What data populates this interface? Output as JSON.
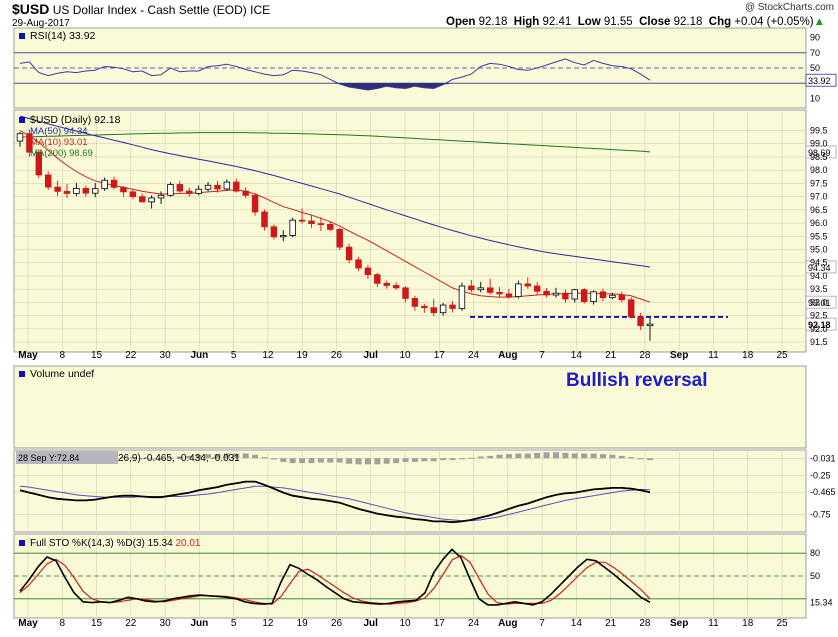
{
  "header": {
    "symbol": "$USD",
    "name": "US Dollar Index - Cash Settle (EOD)",
    "exchange": "ICE",
    "date": "29-Aug-2017",
    "open_label": "Open",
    "open": "92.18",
    "high_label": "High",
    "high": "92.41",
    "low_label": "Low",
    "low": "91.55",
    "close_label": "Close",
    "close": "92.18",
    "chg_label": "Chg",
    "chg": "+0.04 (+0.05%)",
    "brand": "@ StockCharts.com",
    "up_arrow_color": "#1a9a1a"
  },
  "annotation": "Bullish reversal",
  "colors": {
    "panel_bg": "#fafad6",
    "grid": "#c8c8b4",
    "candle_up": "#ffffff",
    "candle_down": "#d01818",
    "ma50": "#2828a0",
    "ma10": "#d02020",
    "ma200": "#1a7a1a",
    "rsi": "#3a3aa0",
    "macd": "#000000",
    "macd_signal": "#5050c0",
    "macd_hist": "#a0a0a0",
    "stoch_k": "#000000",
    "stoch_d": "#d02020",
    "support_line": "#1010b0"
  },
  "chart_data": [
    {
      "type": "line",
      "name": "rsi-panel",
      "legend": "RSI(14) 33.92",
      "last_label": "33.92",
      "ylim": [
        0,
        100
      ],
      "y_ticks": [
        "90",
        "70",
        "50",
        "30",
        "10"
      ],
      "y_tick_values": [
        90,
        70,
        50,
        30,
        10
      ],
      "reference_lines": [
        70,
        50,
        30
      ],
      "values": [
        56,
        58,
        44,
        40,
        43,
        45,
        44,
        46,
        47,
        52,
        51,
        49,
        45,
        46,
        40,
        41,
        50,
        45,
        46,
        46,
        52,
        53,
        55,
        52,
        48,
        45,
        42,
        40,
        41,
        47,
        46,
        44,
        41,
        35,
        29,
        25,
        23,
        21,
        23,
        26,
        24,
        23,
        26,
        24,
        23,
        28,
        35,
        38,
        42,
        52,
        56,
        55,
        52,
        48,
        47,
        50,
        54,
        58,
        62,
        57,
        54,
        60,
        56,
        53,
        52,
        49,
        42,
        33.92
      ]
    },
    {
      "type": "candlestick",
      "name": "price-panel",
      "title": "$USD (Daily) 92.18",
      "legend": [
        {
          "name": "MA(50) 94.34",
          "color": "#2828a0"
        },
        {
          "name": "MA(10) 93.01",
          "color": "#d02020"
        },
        {
          "name": "MA(200) 98.69",
          "color": "#1a7a1a"
        }
      ],
      "ylim": [
        91.2,
        100.2
      ],
      "y_ticks": [
        "99.5",
        "99.0",
        "98.5",
        "98.0",
        "97.5",
        "97.0",
        "96.5",
        "96.0",
        "95.5",
        "95.0",
        "94.5",
        "94.0",
        "93.5",
        "93.0",
        "92.5",
        "92.0",
        "91.5"
      ],
      "y_tick_values": [
        99.5,
        99.0,
        98.5,
        98.0,
        97.5,
        97.0,
        96.5,
        96.0,
        95.5,
        95.0,
        94.5,
        94.0,
        93.5,
        93.0,
        92.5,
        92.0,
        91.5
      ],
      "last_labels": [
        {
          "text": "98.69",
          "value": 98.69
        },
        {
          "text": "94.34",
          "value": 94.34
        },
        {
          "text": "93.01",
          "value": 93.01
        },
        {
          "text": "92.18",
          "value": 92.18
        }
      ],
      "support_level": 92.45,
      "open": [
        99.1,
        99.38,
        98.68,
        97.82,
        97.36,
        97.2,
        97.12,
        97.31,
        97.13,
        97.3,
        97.62,
        97.35,
        97.18,
        97.0,
        96.8,
        96.95,
        97.05,
        97.46,
        97.21,
        97.12,
        97.28,
        97.43,
        97.29,
        97.55,
        97.21,
        97.05,
        96.42,
        95.86,
        95.48,
        95.53,
        96.11,
        96.08,
        95.98,
        95.95,
        95.76,
        95.09,
        94.61,
        94.3,
        94.05,
        93.72,
        93.64,
        93.55,
        93.15,
        92.85,
        92.8,
        92.61,
        92.9,
        92.77,
        93.62,
        93.48,
        93.55,
        93.38,
        93.32,
        93.22,
        93.7,
        93.62,
        93.42,
        93.28,
        93.35,
        93.13,
        93.48,
        93.03,
        93.4,
        93.18,
        93.27,
        93.1,
        92.45,
        92.12
      ],
      "high": [
        99.45,
        99.52,
        98.8,
        97.95,
        97.6,
        97.48,
        97.52,
        97.42,
        97.52,
        97.72,
        97.75,
        97.4,
        97.3,
        97.12,
        97.05,
        97.2,
        97.55,
        97.6,
        97.35,
        97.42,
        97.55,
        97.6,
        97.65,
        97.68,
        97.36,
        97.12,
        96.52,
        95.95,
        95.73,
        96.2,
        96.55,
        96.3,
        96.22,
        96.04,
        95.82,
        95.22,
        94.72,
        94.42,
        94.12,
        93.82,
        93.76,
        93.61,
        93.25,
        92.95,
        93.12,
        92.98,
        93.05,
        93.75,
        93.85,
        93.78,
        93.9,
        93.58,
        93.5,
        93.82,
        93.95,
        93.78,
        93.55,
        93.55,
        93.48,
        93.5,
        93.55,
        93.45,
        93.52,
        93.36,
        93.4,
        93.2,
        92.6,
        92.41
      ],
      "low": [
        98.88,
        98.52,
        97.7,
        97.25,
        97.02,
        96.95,
        97.02,
        97.0,
        96.98,
        97.22,
        97.28,
        97.0,
        96.9,
        96.8,
        96.55,
        96.72,
        97.0,
        97.15,
        97.0,
        97.05,
        97.2,
        97.15,
        97.22,
        97.15,
        96.95,
        96.28,
        95.72,
        95.38,
        95.32,
        95.46,
        95.98,
        95.82,
        95.7,
        95.7,
        94.98,
        94.48,
        94.18,
        93.88,
        93.58,
        93.52,
        93.48,
        93.02,
        92.68,
        92.6,
        92.48,
        92.5,
        92.62,
        92.68,
        93.38,
        93.38,
        93.3,
        93.2,
        93.14,
        93.15,
        93.52,
        93.28,
        93.18,
        93.18,
        93.0,
        93.0,
        92.95,
        92.92,
        93.05,
        93.12,
        93.0,
        92.4,
        91.95,
        91.55
      ],
      "close": [
        99.38,
        98.68,
        97.82,
        97.36,
        97.2,
        97.12,
        97.31,
        97.13,
        97.3,
        97.62,
        97.35,
        97.18,
        97.0,
        96.8,
        96.95,
        97.05,
        97.46,
        97.21,
        97.12,
        97.28,
        97.43,
        97.29,
        97.55,
        97.21,
        97.05,
        96.42,
        95.86,
        95.48,
        95.53,
        96.11,
        96.08,
        95.98,
        95.95,
        95.76,
        95.09,
        94.61,
        94.3,
        94.05,
        93.72,
        93.64,
        93.55,
        93.15,
        92.85,
        92.8,
        92.61,
        92.9,
        92.77,
        93.62,
        93.48,
        93.55,
        93.38,
        93.32,
        93.22,
        93.7,
        93.62,
        93.42,
        93.28,
        93.35,
        93.13,
        93.48,
        93.03,
        93.4,
        93.18,
        93.27,
        93.1,
        92.45,
        92.12,
        92.18
      ],
      "ma10": [
        99.5,
        99.3,
        99.05,
        98.75,
        98.45,
        98.18,
        97.95,
        97.75,
        97.6,
        97.5,
        97.42,
        97.35,
        97.28,
        97.2,
        97.15,
        97.1,
        97.1,
        97.12,
        97.13,
        97.15,
        97.18,
        97.2,
        97.24,
        97.25,
        97.2,
        97.1,
        96.95,
        96.78,
        96.62,
        96.52,
        96.4,
        96.3,
        96.18,
        96.05,
        95.88,
        95.7,
        95.52,
        95.35,
        95.15,
        94.95,
        94.75,
        94.55,
        94.35,
        94.15,
        93.95,
        93.75,
        93.55,
        93.42,
        93.32,
        93.25,
        93.22,
        93.2,
        93.2,
        93.22,
        93.25,
        93.28,
        93.3,
        93.32,
        93.33,
        93.35,
        93.35,
        93.34,
        93.33,
        93.32,
        93.3,
        93.25,
        93.13,
        93.01
      ],
      "ma50": [
        100.05,
        99.95,
        99.85,
        99.75,
        99.66,
        99.57,
        99.48,
        99.39,
        99.3,
        99.22,
        99.13,
        99.05,
        98.96,
        98.87,
        98.78,
        98.7,
        98.62,
        98.55,
        98.48,
        98.41,
        98.35,
        98.28,
        98.21,
        98.14,
        98.06,
        97.98,
        97.89,
        97.8,
        97.7,
        97.6,
        97.5,
        97.4,
        97.3,
        97.2,
        97.1,
        96.98,
        96.86,
        96.74,
        96.62,
        96.5,
        96.39,
        96.27,
        96.16,
        96.04,
        95.93,
        95.82,
        95.72,
        95.62,
        95.52,
        95.43,
        95.34,
        95.26,
        95.18,
        95.1,
        95.03,
        94.96,
        94.9,
        94.84,
        94.79,
        94.74,
        94.69,
        94.64,
        94.59,
        94.54,
        94.49,
        94.44,
        94.39,
        94.34
      ],
      "ma200": [
        99.25,
        99.26,
        99.27,
        99.28,
        99.29,
        99.3,
        99.31,
        99.32,
        99.33,
        99.34,
        99.35,
        99.36,
        99.37,
        99.38,
        99.39,
        99.4,
        99.4,
        99.41,
        99.41,
        99.42,
        99.42,
        99.42,
        99.42,
        99.42,
        99.42,
        99.41,
        99.41,
        99.4,
        99.4,
        99.39,
        99.38,
        99.37,
        99.36,
        99.35,
        99.34,
        99.33,
        99.31,
        99.3,
        99.28,
        99.26,
        99.24,
        99.22,
        99.2,
        99.18,
        99.16,
        99.14,
        99.12,
        99.1,
        99.08,
        99.06,
        99.04,
        99.02,
        99.0,
        98.98,
        98.96,
        98.94,
        98.92,
        98.9,
        98.88,
        98.86,
        98.84,
        98.82,
        98.8,
        98.78,
        98.76,
        98.74,
        98.72,
        98.69
      ]
    },
    {
      "type": "bar",
      "name": "volume-panel",
      "legend": "Volume undef"
    },
    {
      "type": "line",
      "name": "macd-panel",
      "legend_prefix": "28 Sep Y:72.84",
      "legend": "26,9) -0.465, -0.434, -0.031",
      "ylim": [
        -0.95,
        0.05
      ],
      "y_ticks": [
        "-0.031",
        "-0.25",
        "-0.465",
        "-0.75"
      ],
      "y_tick_values": [
        -0.031,
        -0.25,
        -0.465,
        -0.75
      ],
      "macd": [
        -0.44,
        -0.47,
        -0.5,
        -0.53,
        -0.55,
        -0.56,
        -0.57,
        -0.57,
        -0.56,
        -0.54,
        -0.52,
        -0.51,
        -0.51,
        -0.52,
        -0.53,
        -0.53,
        -0.51,
        -0.49,
        -0.47,
        -0.44,
        -0.42,
        -0.4,
        -0.37,
        -0.35,
        -0.33,
        -0.33,
        -0.37,
        -0.42,
        -0.47,
        -0.51,
        -0.53,
        -0.55,
        -0.56,
        -0.58,
        -0.6,
        -0.64,
        -0.68,
        -0.71,
        -0.74,
        -0.76,
        -0.78,
        -0.79,
        -0.81,
        -0.82,
        -0.84,
        -0.84,
        -0.85,
        -0.84,
        -0.82,
        -0.79,
        -0.76,
        -0.72,
        -0.68,
        -0.64,
        -0.61,
        -0.57,
        -0.53,
        -0.5,
        -0.48,
        -0.47,
        -0.45,
        -0.43,
        -0.42,
        -0.41,
        -0.41,
        -0.42,
        -0.44,
        -0.465
      ],
      "signal": [
        -0.39,
        -0.4,
        -0.42,
        -0.44,
        -0.46,
        -0.48,
        -0.5,
        -0.51,
        -0.52,
        -0.53,
        -0.53,
        -0.53,
        -0.53,
        -0.52,
        -0.52,
        -0.52,
        -0.52,
        -0.52,
        -0.51,
        -0.5,
        -0.49,
        -0.47,
        -0.45,
        -0.43,
        -0.41,
        -0.39,
        -0.39,
        -0.4,
        -0.41,
        -0.43,
        -0.45,
        -0.47,
        -0.49,
        -0.51,
        -0.53,
        -0.55,
        -0.58,
        -0.61,
        -0.64,
        -0.67,
        -0.7,
        -0.73,
        -0.75,
        -0.77,
        -0.79,
        -0.81,
        -0.82,
        -0.83,
        -0.83,
        -0.82,
        -0.8,
        -0.78,
        -0.75,
        -0.72,
        -0.69,
        -0.66,
        -0.63,
        -0.6,
        -0.57,
        -0.55,
        -0.53,
        -0.51,
        -0.49,
        -0.47,
        -0.45,
        -0.44,
        -0.43,
        -0.434
      ],
      "histogram": [
        -0.05,
        -0.07,
        -0.08,
        -0.09,
        -0.09,
        -0.08,
        -0.07,
        -0.06,
        -0.04,
        -0.01,
        0.01,
        0.02,
        0.02,
        0.0,
        -0.01,
        -0.01,
        0.01,
        0.03,
        0.04,
        0.06,
        0.07,
        0.07,
        0.08,
        0.08,
        0.08,
        0.06,
        0.02,
        -0.02,
        -0.06,
        -0.08,
        -0.08,
        -0.08,
        -0.07,
        -0.07,
        -0.07,
        -0.09,
        -0.1,
        -0.1,
        -0.1,
        -0.09,
        -0.08,
        -0.06,
        -0.06,
        -0.05,
        -0.05,
        -0.03,
        -0.03,
        -0.01,
        0.01,
        0.03,
        0.04,
        0.06,
        0.07,
        0.08,
        0.08,
        0.09,
        0.1,
        0.1,
        0.09,
        0.08,
        0.08,
        0.08,
        0.07,
        0.06,
        0.04,
        0.02,
        -0.01,
        -0.031
      ]
    },
    {
      "type": "line",
      "name": "stoch-panel",
      "legend_label": "Full STO %K(14,3) %D(3)",
      "k_label": "15.34",
      "d_label": "20.01",
      "ylim": [
        0,
        100
      ],
      "y_ticks": [
        "80",
        "50",
        "15.34"
      ],
      "y_tick_values": [
        80,
        50,
        15.34
      ],
      "reference_lines": [
        80,
        50,
        20
      ],
      "k": [
        30,
        45,
        62,
        75,
        70,
        48,
        28,
        16,
        15,
        16,
        15,
        18,
        22,
        20,
        17,
        16,
        17,
        20,
        22,
        24,
        25,
        24,
        23,
        22,
        20,
        16,
        14,
        13,
        14,
        42,
        65,
        60,
        52,
        45,
        36,
        28,
        20,
        16,
        15,
        14,
        13,
        14,
        16,
        17,
        18,
        28,
        55,
        72,
        85,
        74,
        46,
        20,
        12,
        12,
        14,
        16,
        14,
        12,
        16,
        26,
        38,
        50,
        62,
        72,
        70,
        61,
        52,
        42,
        32,
        22,
        15.34
      ],
      "d": [
        28,
        38,
        52,
        66,
        72,
        64,
        48,
        30,
        20,
        16,
        15,
        16,
        18,
        20,
        19,
        17,
        16,
        18,
        20,
        22,
        24,
        24,
        24,
        23,
        21,
        19,
        16,
        14,
        13,
        23,
        40,
        56,
        59,
        52,
        44,
        36,
        28,
        21,
        17,
        15,
        14,
        13,
        14,
        15,
        17,
        21,
        34,
        52,
        71,
        77,
        68,
        47,
        26,
        15,
        13,
        14,
        14,
        14,
        14,
        18,
        27,
        38,
        50,
        61,
        68,
        68,
        61,
        52,
        42,
        32,
        20.01
      ],
      "k_note": "stochastic series sampled densely across the same date span"
    }
  ],
  "x_axis": {
    "labels": [
      "May",
      "8",
      "15",
      "22",
      "30",
      "Jun",
      "5",
      "12",
      "19",
      "26",
      "Jul",
      "10",
      "17",
      "24",
      "Aug",
      "7",
      "14",
      "21",
      "28",
      "Sep",
      "11",
      "18",
      "25"
    ],
    "bold": [
      true,
      false,
      false,
      false,
      false,
      true,
      false,
      false,
      false,
      false,
      true,
      false,
      false,
      false,
      true,
      false,
      false,
      false,
      false,
      true,
      false,
      false,
      false
    ]
  }
}
